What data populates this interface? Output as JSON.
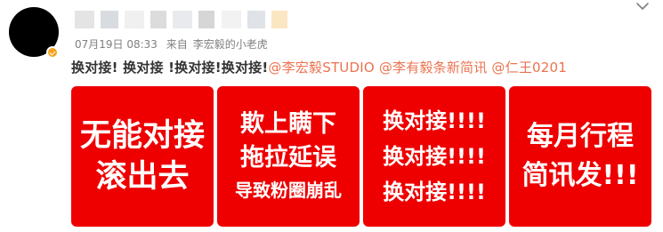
{
  "post": {
    "timestamp": "07月19日 08:33",
    "source_prefix": "来自",
    "source_name": "李宏毅的小老虎",
    "text_segments": [
      {
        "type": "plain",
        "text": "换对接! 换对接 !换对接!换对接!"
      },
      {
        "type": "mention",
        "text": "@李宏毅STUDIO"
      },
      {
        "type": "plain",
        "text": " "
      },
      {
        "type": "mention",
        "text": "@李有毅条新简讯"
      },
      {
        "type": "plain",
        "text": " "
      },
      {
        "type": "mention",
        "text": "@仁王0201"
      }
    ]
  },
  "cards": [
    {
      "lines": [
        "无能对接",
        "滚出去"
      ]
    },
    {
      "lines": [
        "欺上瞒下",
        "拖拉延误",
        "导致粉圈崩乱"
      ]
    },
    {
      "lines": [
        "换对接!!!!",
        "换对接!!!!",
        "换对接!!!!"
      ]
    },
    {
      "lines": [
        "每月行程",
        "简讯发!!!"
      ]
    }
  ],
  "icons": {
    "avatar": "avatar",
    "verified": "verified-badge-icon",
    "more": "chevron-down-icon"
  },
  "colors": {
    "card_bg": "#ee0000",
    "mention": "#eb7350",
    "badge": "#f7a21b"
  }
}
